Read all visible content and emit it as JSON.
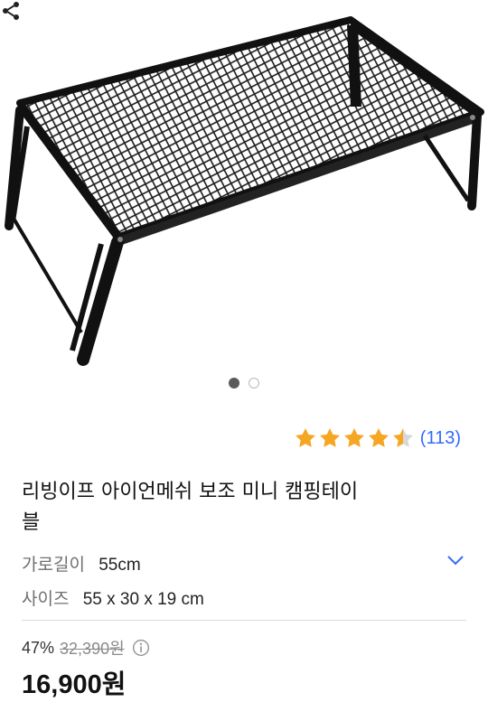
{
  "gallery": {
    "image_alt": "black iron mesh folding camping table",
    "active_index": 0,
    "total": 2
  },
  "rating": {
    "stars": 4.5,
    "count_text": "(113)",
    "star_color": "#f5a623"
  },
  "product": {
    "title": "리빙이프 아이언메쉬 보조 미니 캠핑테이블"
  },
  "options": [
    {
      "label": "가로길이",
      "value": "55cm"
    },
    {
      "label": "사이즈",
      "value": "55 x 30 x 19 cm"
    }
  ],
  "pricing": {
    "discount": "47%",
    "original": "32,390원",
    "price": "16,900원"
  },
  "colors": {
    "link": "#346aff"
  }
}
